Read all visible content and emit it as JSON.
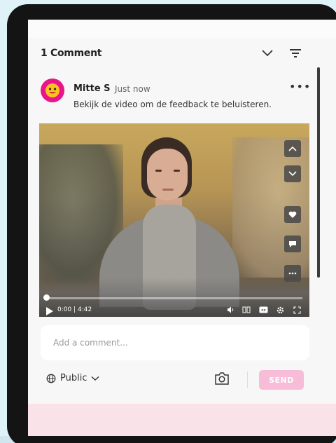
{
  "header": {
    "comment_count": "1 Comment"
  },
  "comment": {
    "author": "Mitte S",
    "time": "Just now",
    "text": "Bekijk de video om de feedback te beluisteren.",
    "more": "•••"
  },
  "video": {
    "timecode": "0:00 | 4:42",
    "progress": 0,
    "icons": [
      "chevron-up-icon",
      "chevron-down-icon",
      "heart-icon",
      "comment-icon",
      "more-icon",
      "play-icon",
      "volume-icon",
      "chapters-icon",
      "captions-icon",
      "settings-icon",
      "fullscreen-icon"
    ]
  },
  "composer": {
    "placeholder": "Add a comment..."
  },
  "footer": {
    "visibility": "Public",
    "send_label": "SEND"
  },
  "colors": {
    "accent": "#e8158a",
    "send_disabled": "#f6bcd8",
    "bottom_strip": "#f9e2e8"
  }
}
